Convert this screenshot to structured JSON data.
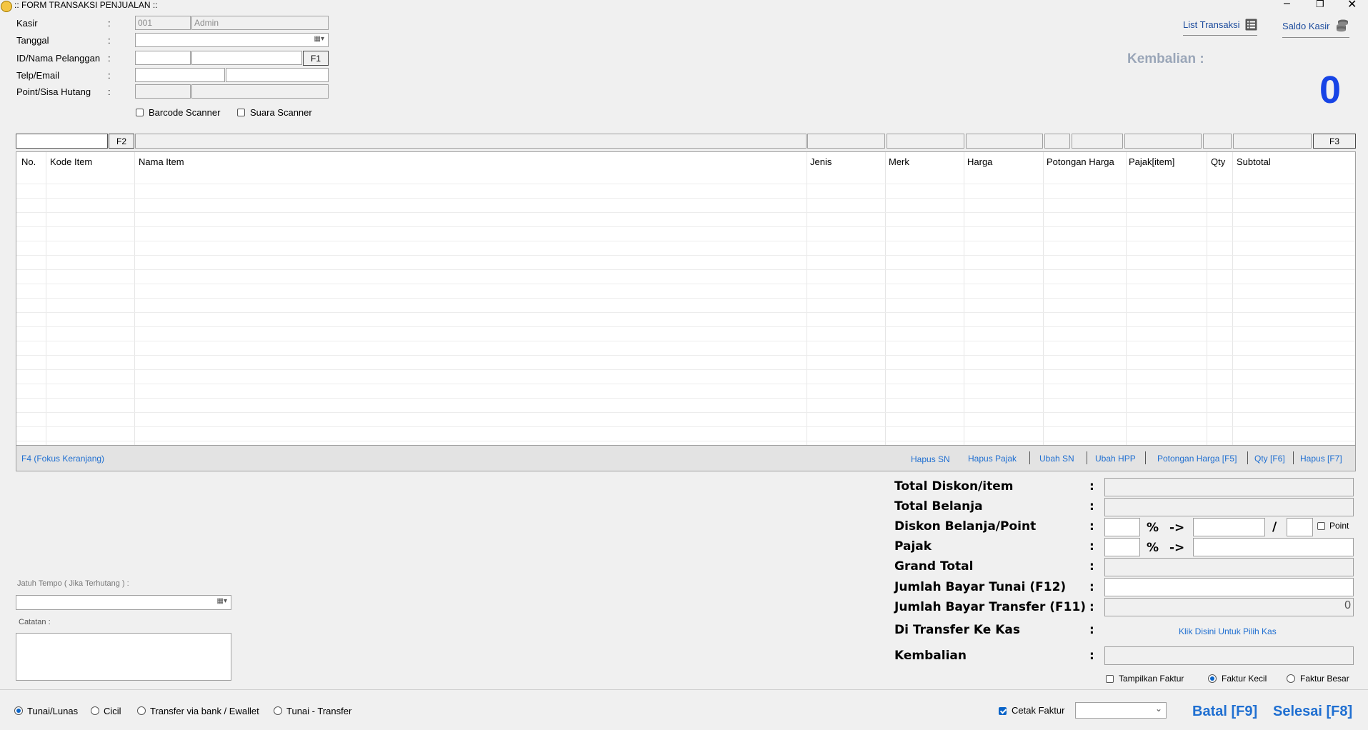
{
  "window": {
    "title": ":: FORM TRANSAKSI PENJUALAN ::",
    "controls": [
      "–",
      "❐",
      "✕"
    ]
  },
  "header": {
    "kasir_label": "Kasir",
    "kasir_id": "001",
    "kasir_name": "Admin",
    "tanggal_label": "Tanggal",
    "pelanggan_label": "ID/Nama Pelanggan",
    "f1": "F1",
    "telp_label": "Telp/Email",
    "point_label": "Point/Sisa Hutang",
    "colon": ":",
    "barcode_label": "Barcode Scanner",
    "suara_label": "Suara Scanner"
  },
  "toplinks": {
    "list_transaksi": "List Transaksi",
    "saldo_kasir": "Saldo Kasir"
  },
  "kembalian_top": {
    "label": "Kembalian :",
    "value": "0"
  },
  "entry": {
    "f2": "F2",
    "f3": "F3"
  },
  "table": {
    "columns": [
      "No.",
      "Kode Item",
      "Nama Item",
      "Jenis",
      "Merk",
      "Harga",
      "Potongan Harga",
      "Pajak[item]",
      "Qty",
      "Subtotal"
    ],
    "rows": []
  },
  "footer_links": {
    "focus": "F4 (Fokus Keranjang)",
    "hapus_sn": "Hapus SN",
    "hapus_pajak": "Hapus Pajak",
    "ubah_sn": "Ubah SN",
    "ubah_hpp": "Ubah HPP",
    "potongan": "Potongan Harga [F5]",
    "qty": "Qty [F6]",
    "hapus": "Hapus [F7]"
  },
  "left_bottom": {
    "jatuh_tempo_label": "Jatuh Tempo ( Jika Terhutang ) :",
    "catatan_label": "Catatan :"
  },
  "summary": {
    "total_diskon": "Total Diskon/item",
    "total_belanja": "Total Belanja",
    "diskon_belanja": "Diskon Belanja/Point",
    "pajak": "Pajak",
    "grand_total": "Grand Total",
    "bayar_tunai": "Jumlah Bayar Tunai (F12)",
    "bayar_transfer": "Jumlah Bayar Transfer (F11)",
    "transfer_kas": "Di Transfer Ke Kas",
    "kembalian": "Kembalian",
    "colon": ":",
    "percent": "%",
    "arrow": "->",
    "slash": "/",
    "point_label": "Point",
    "transfer_value": "0",
    "pilih_kas": "Klik Disini Untuk Pilih Kas",
    "tampilkan_faktur": "Tampilkan Faktur",
    "faktur_kecil": "Faktur Kecil",
    "faktur_besar": "Faktur Besar"
  },
  "payment": {
    "tunai": "Tunai/Lunas",
    "cicil": "Cicil",
    "transfer": "Transfer via bank / Ewallet",
    "tunai_transfer": "Tunai - Transfer",
    "cetak_faktur": "Cetak Faktur",
    "batal": "Batal [F9]",
    "selesai": "Selesai [F8]"
  },
  "colors": {
    "accent": "#0a64c8",
    "link": "#1f6fd1",
    "big_zero": "#1744e6"
  }
}
